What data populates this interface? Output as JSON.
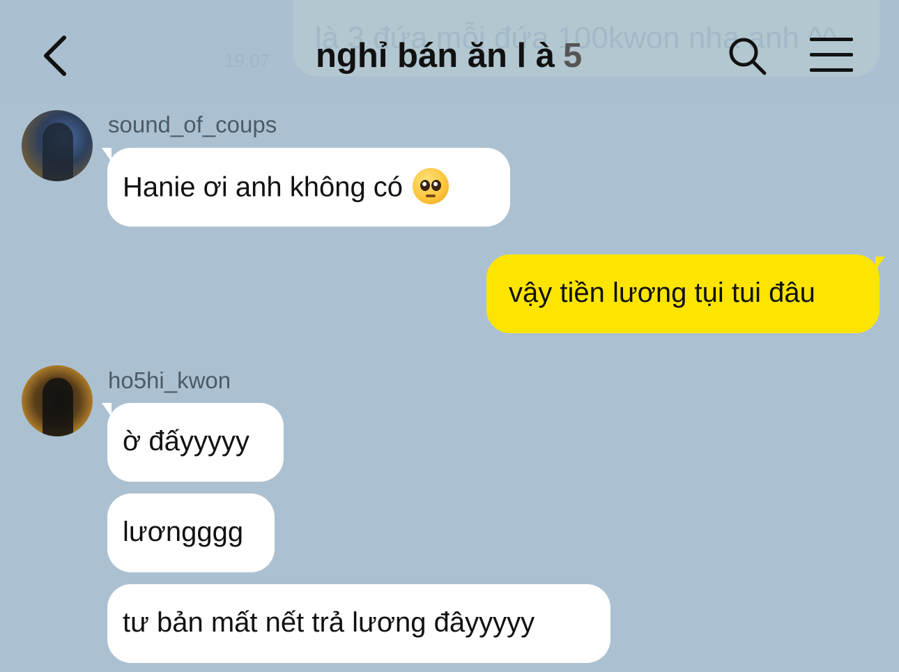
{
  "header": {
    "pinned_preview": "là 3 đứa mỗi đứa 100kwon nha anh ^^",
    "pinned_time": "19:07",
    "title": "nghỉ bán ăn l à",
    "member_count": "5"
  },
  "messages": [
    {
      "sender": "sound_of_coups",
      "text": "Hanie ơi anh không có",
      "emoji": "pleading-face"
    },
    {
      "sender": "me",
      "text": "vậy tiền lương tụi tui đâu"
    },
    {
      "sender": "ho5hi_kwon",
      "text": "ờ đấyyyyy"
    },
    {
      "sender": "ho5hi_kwon",
      "text": "lươngggg"
    },
    {
      "sender": "ho5hi_kwon",
      "text": "tư bản mất nết trả lương đâyyyyy"
    }
  ],
  "colors": {
    "background": "#abc1d2",
    "my_bubble": "#fee500",
    "other_bubble": "#ffffff"
  }
}
